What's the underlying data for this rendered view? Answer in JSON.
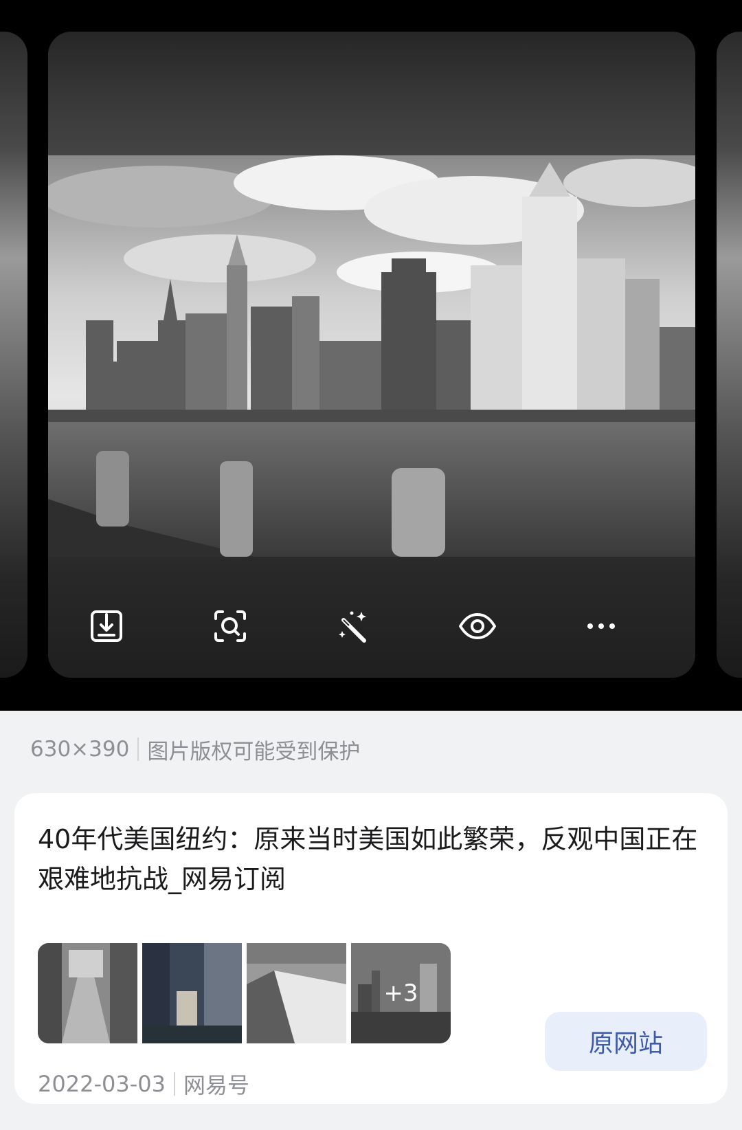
{
  "viewer": {
    "photo_alt": "40年代美国纽约",
    "toolbar": [
      {
        "icon": "download-icon"
      },
      {
        "icon": "image-search-icon"
      },
      {
        "icon": "magic-wand-icon"
      },
      {
        "icon": "eye-icon"
      },
      {
        "icon": "more-icon"
      }
    ]
  },
  "info": {
    "dimensions": "630×390",
    "copyright": "图片版权可能受到保护"
  },
  "result": {
    "title": "40年代美国纽约：原来当时美国如此繁荣，反观中国正在艰难地抗战_网易订阅",
    "more_count": "+3",
    "date": "2022-03-03",
    "source": "网易号",
    "origin_button": "原网站"
  },
  "colors": {
    "accent_text": "#3d5ba9",
    "button_bg": "#e9eefb",
    "sheet_bg": "#f1f2f4"
  }
}
